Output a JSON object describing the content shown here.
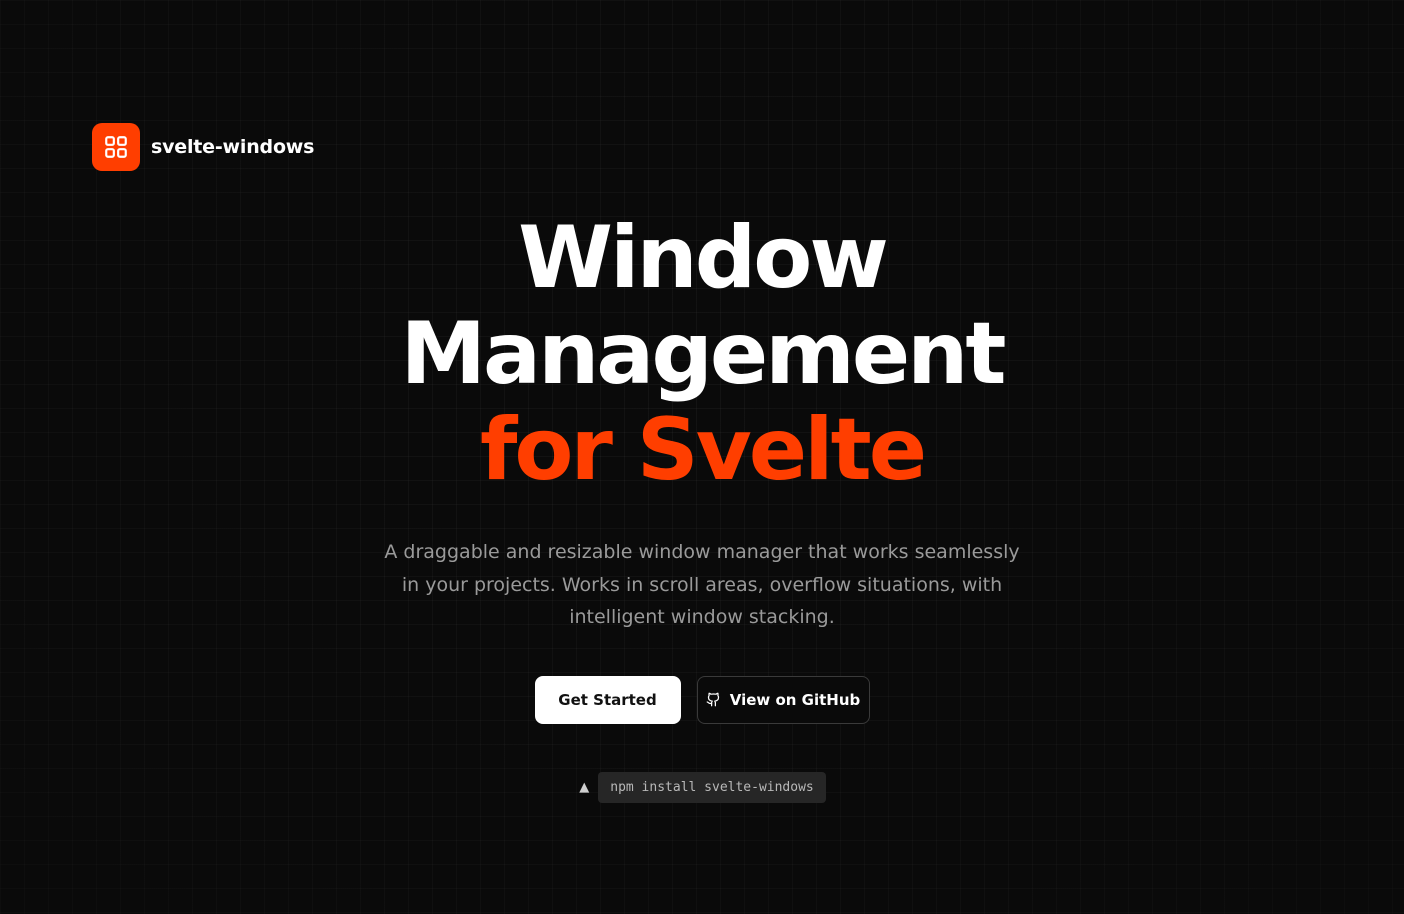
{
  "brand": {
    "name": "svelte-windows",
    "logo_icon": "grid-icon",
    "accent_color": "#ff3e00"
  },
  "hero": {
    "headline_line1": "Window",
    "headline_line2": "Management",
    "headline_line3": "for Svelte",
    "subtitle": "A draggable and resizable window manager that works seamlessly in your projects. Works in scroll areas, overflow situations, with intelligent window stacking."
  },
  "actions": {
    "primary_label": "Get Started",
    "secondary_label": "View on GitHub",
    "secondary_icon": "github-icon"
  },
  "install": {
    "icon": "triangle-icon",
    "icon_glyph": "▲",
    "command": "npm install svelte-windows"
  }
}
